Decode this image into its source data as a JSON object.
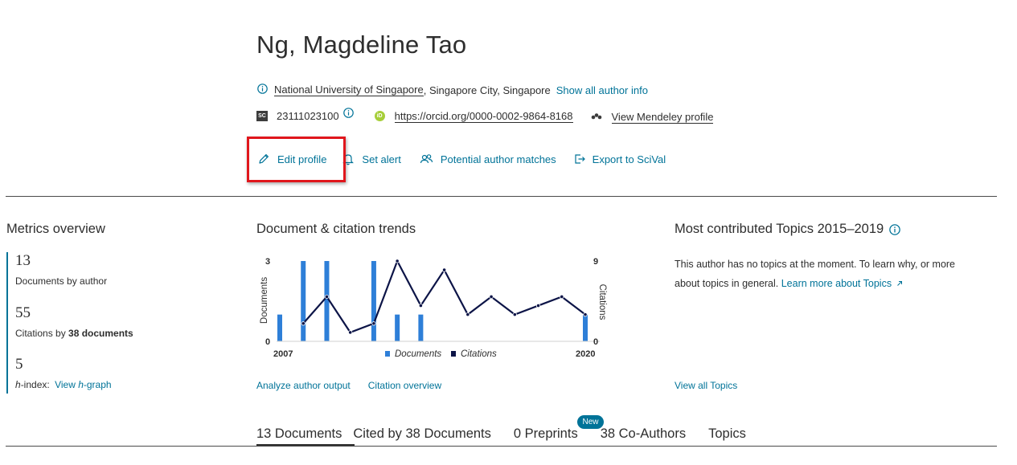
{
  "author": {
    "name": "Ng, Magdeline Tao",
    "affiliation": "National University of Singapore",
    "location": ", Singapore City, Singapore",
    "show_all_info": "Show all author info",
    "scopus_badge": "SC",
    "scopus_id": "23111023100",
    "orcid_badge": "iD",
    "orcid_url": "https://orcid.org/0000-0002-9864-8168",
    "mendeley_link": "View Mendeley profile"
  },
  "actions": {
    "edit_profile": "Edit profile",
    "set_alert": "Set alert",
    "potential_matches": "Potential author matches",
    "export_scival": "Export to SciVal"
  },
  "metrics": {
    "title": "Metrics overview",
    "documents_value": "13",
    "documents_label": "Documents by author",
    "citations_value": "55",
    "citations_label_pre": "Citations by ",
    "citations_label_bold": "38 documents",
    "hindex_value": "5",
    "hindex_label_pre": "h",
    "hindex_label_post": "-index:",
    "view_hgraph_pre": "View ",
    "view_hgraph_italic": "h",
    "view_hgraph_post": "-graph"
  },
  "trends": {
    "title": "Document & citation trends",
    "analyze_link": "Analyze author output",
    "citation_overview_link": "Citation overview"
  },
  "chart_data": {
    "type": "bar",
    "x": [
      2007,
      2008,
      2009,
      2010,
      2011,
      2012,
      2013,
      2014,
      2015,
      2016,
      2017,
      2018,
      2019,
      2020
    ],
    "x_tick_labels": [
      "2007",
      "2020"
    ],
    "series": [
      {
        "name": "Documents",
        "type": "bar",
        "axis": "left",
        "values": [
          1,
          3,
          3,
          0,
          3,
          1,
          1,
          0,
          0,
          0,
          0,
          0,
          0,
          1
        ]
      },
      {
        "name": "Citations",
        "type": "line",
        "axis": "right",
        "values": [
          null,
          2,
          5,
          1,
          2,
          9,
          4,
          8,
          3,
          5,
          3,
          4,
          5,
          3
        ]
      }
    ],
    "ylabel": "Documents",
    "y2label": "Citations",
    "ylim": [
      0,
      3
    ],
    "y2lim": [
      0,
      9
    ],
    "y_ticks": [
      "0",
      "3"
    ],
    "y2_ticks": [
      "0",
      "9"
    ],
    "legend": "bottom",
    "colors": {
      "bar": "#2e7fd8",
      "line": "#0c1447"
    }
  },
  "topics": {
    "title": "Most contributed Topics 2015–2019",
    "text_line1": "This author has no topics at the moment. To learn why, or more",
    "text_line2": "about topics in general. ",
    "learn_more": "Learn more about Topics",
    "view_all": "View all Topics"
  },
  "tabs": [
    {
      "label": "13 Documents"
    },
    {
      "label": "Cited by 38 Documents"
    },
    {
      "label": "0 Preprints"
    },
    {
      "label": "38 Co-Authors"
    },
    {
      "label": "Topics"
    }
  ],
  "new_badge": "New",
  "colors": {
    "link": "#007398",
    "highlight": "#e0161c",
    "accent_bar": "#007398"
  }
}
